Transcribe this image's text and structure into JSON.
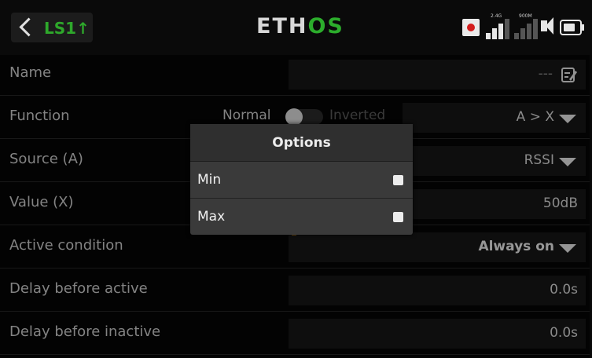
{
  "header": {
    "title": "LS1↑",
    "logo_left": "ETH",
    "logo_right": "OS",
    "status": {
      "receiver_1_label": "2.4G",
      "receiver_2_label": "900M"
    }
  },
  "rows": [
    {
      "label": "Name",
      "value": "---"
    },
    {
      "label": "Function",
      "normal_label": "Normal",
      "inverted_label": "Inverted",
      "value": "A > X"
    },
    {
      "label": "Source (A)",
      "value": "RSSI"
    },
    {
      "label": "Value (X)",
      "value": "50dB"
    },
    {
      "label": "Active condition",
      "value": "Always on"
    },
    {
      "label": "Delay before active",
      "value": "0.0s"
    },
    {
      "label": "Delay before inactive",
      "value": "0.0s"
    }
  ],
  "dialog": {
    "title": "Options",
    "options": [
      {
        "label": "Min",
        "checked": false
      },
      {
        "label": "Max",
        "checked": false
      }
    ]
  },
  "colors": {
    "accent_green": "#2ea82b",
    "record_red": "#d41d1d"
  }
}
